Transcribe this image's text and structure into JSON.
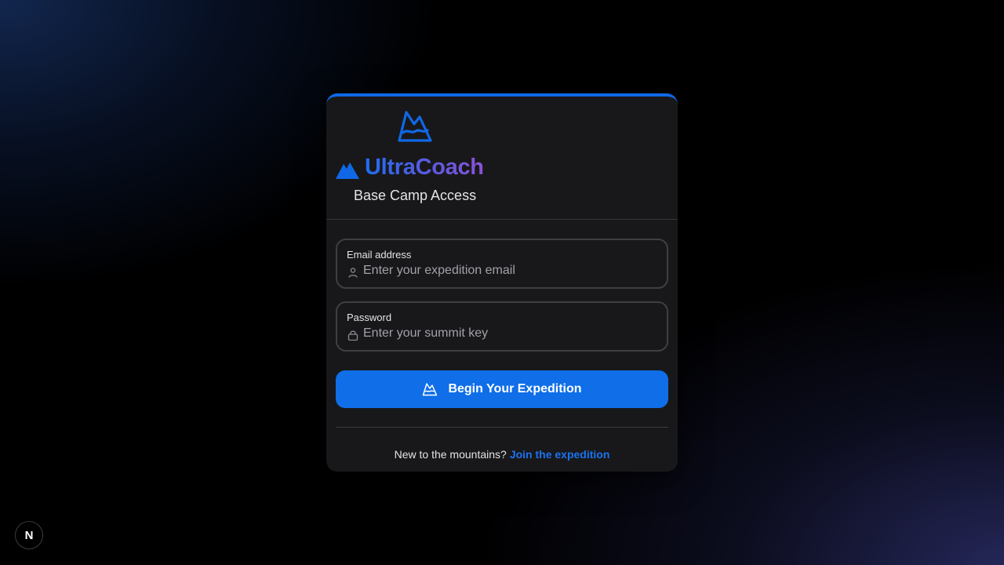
{
  "brand": {
    "name": "UltraCoach",
    "subtitle": "Base Camp Access",
    "accent_color": "#0f6ee8",
    "gradient_colors": [
      "#1f6df0",
      "#8a52d6"
    ],
    "logo_icon": "mountain-icon",
    "peak_icon": "mountain-peak-icon"
  },
  "form": {
    "email": {
      "label": "Email address",
      "placeholder": "Enter your expedition email",
      "value": "",
      "icon": "user-icon"
    },
    "password": {
      "label": "Password",
      "placeholder": "Enter your summit key",
      "value": "",
      "icon": "lock-icon"
    },
    "submit": {
      "label": "Begin Your Expedition",
      "icon": "mountain-icon"
    }
  },
  "signup": {
    "prompt": "New to the mountains?",
    "link_label": "Join the expedition"
  },
  "dev_badge": {
    "label": "N",
    "icon": "nextjs-icon"
  }
}
